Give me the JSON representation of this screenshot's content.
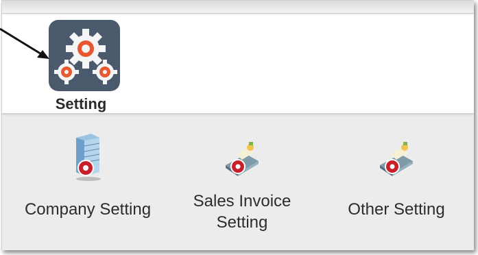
{
  "header": {
    "setting_label": "Setting",
    "setting_icon": "gear-settings-icon"
  },
  "menu": {
    "items": [
      {
        "label": "Company Setting",
        "icon": "building-settings-icon"
      },
      {
        "label": "Sales Invoice Setting",
        "line1": "Sales Invoice",
        "line2": "Setting",
        "icon": "invoice-settings-icon"
      },
      {
        "label": "Other Setting",
        "icon": "other-settings-icon"
      }
    ]
  },
  "colors": {
    "icon_bg": "#4a5a6c",
    "gear_orange": "#e8572f",
    "gear_white": "#f5f5f5",
    "panel_bg": "#ececec",
    "red_badge": "#c8202a"
  }
}
